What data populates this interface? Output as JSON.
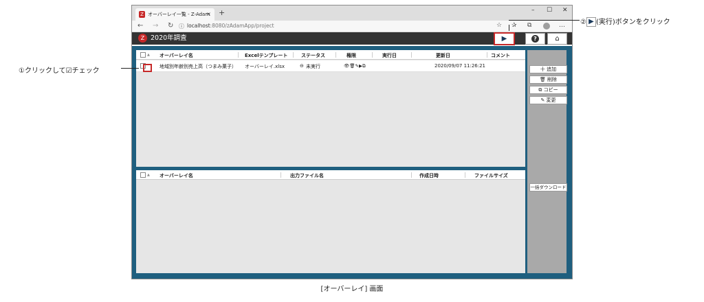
{
  "browser": {
    "tab_title": "オーバーレイ一覧 - Z-Adam",
    "url_host": "localhost",
    "url_rest": ":8080/zAdamApp/project",
    "new_tab": "+",
    "win_min": "–",
    "win_max": "☐",
    "win_close": "✕",
    "nav_back": "←",
    "nav_forward": "→",
    "nav_reload": "↻",
    "info_icon": "ⓘ",
    "fav_star": "☆",
    "favs": "✰",
    "collections": "⧉",
    "more": "…",
    "tab_close": "×"
  },
  "app": {
    "logo": "Z",
    "title": "2020年調査",
    "run_icon": "▶",
    "help_icon": "?",
    "home_icon": "⌂"
  },
  "upper_table": {
    "columns": [
      "オーバーレイ名",
      "Excelテンプレート",
      "ステータス",
      "権限",
      "実行日",
      "更新日",
      "コメント"
    ],
    "sort_icon": "▲",
    "rows": [
      {
        "name": "地域別年齢別売上高（つまみ菓子）",
        "template": "オーバーレイ.xlsx",
        "status": "未実行",
        "status_icon": "⊖",
        "perm_icons": "👁🗑✎▶⧉",
        "executed": "",
        "updated": "2020/09/07 11:26:21",
        "comment": ""
      }
    ]
  },
  "side_buttons": {
    "add": "十 追加",
    "delete": "🗑 削除",
    "copy": "⧉ コピー",
    "edit": "✎ 変更",
    "bulk_download": "一括ダウンロード"
  },
  "lower_table": {
    "columns": [
      "オーバーレイ名",
      "出力ファイル名",
      "作成日時",
      "ファイルサイズ"
    ],
    "sort_icon": "▲"
  },
  "annotations": {
    "step1": "①クリックして☑チェック",
    "step2_prefix": "②",
    "step2_icon": "▶",
    "step2_suffix": "(実行)ボタンをクリック"
  },
  "caption": "[オーバーレイ] 画面",
  "colors": {
    "accent": "#c62828",
    "frame": "#1f5f7f",
    "appbar": "#333333"
  }
}
